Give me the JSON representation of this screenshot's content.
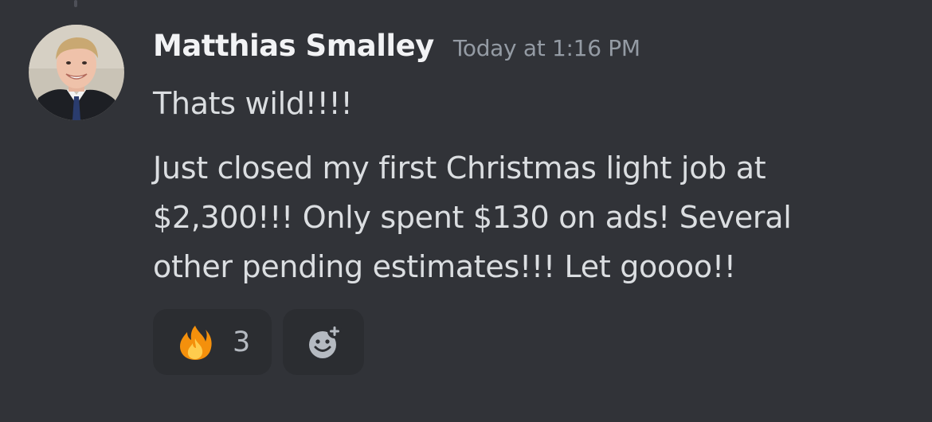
{
  "message": {
    "author": "Matthias Smalley",
    "timestamp": "Today at 1:16 PM",
    "lines": [
      "Thats wild!!!!",
      "Just closed my first Christmas light job at",
      "$2,300!!! Only spent $130 on ads! Several",
      "other pending estimates!!! Let goooo!!"
    ]
  },
  "reactions": [
    {
      "emoji": "fire-icon",
      "count": "3"
    }
  ],
  "add_reaction": {
    "icon": "add-reaction-icon"
  },
  "colors": {
    "background": "#313338",
    "username": "#f2f3f5",
    "timestamp": "#949ba4",
    "text": "#dbdee1",
    "reaction_bg": "#2b2d31"
  }
}
